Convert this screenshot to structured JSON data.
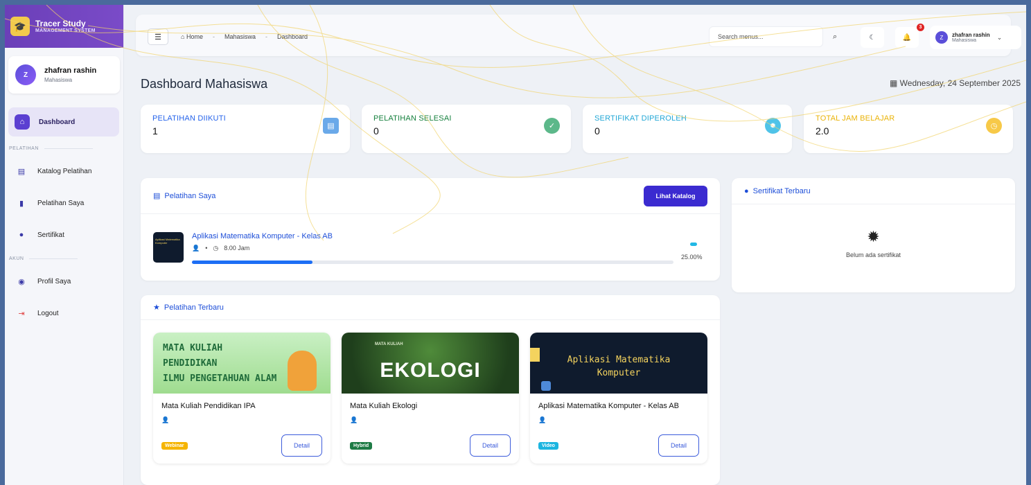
{
  "brand": {
    "title": "Tracer Study",
    "subtitle": "MANAGEMENT SYSTEM",
    "logo_icon": "graduate-icon"
  },
  "user": {
    "initial": "Z",
    "name": "zhafran rashin",
    "role": "Mahasiswa"
  },
  "sidebar": {
    "active": {
      "label": "Dashboard",
      "icon": "home-icon"
    },
    "section_pelatihan": "PELATIHAN",
    "pelatihan_items": [
      {
        "label": "Katalog Pelatihan",
        "icon": "book-icon"
      },
      {
        "label": "Pelatihan Saya",
        "icon": "bookmark-icon"
      },
      {
        "label": "Sertifikat",
        "icon": "certificate-icon"
      }
    ],
    "section_akun": "AKUN",
    "akun_items": [
      {
        "label": "Profil Saya",
        "icon": "user-circle-icon"
      },
      {
        "label": "Logout",
        "icon": "logout-icon"
      }
    ]
  },
  "topbar": {
    "breadcrumbs": [
      "Home",
      "Mahasiswa",
      "Dashboard"
    ],
    "search_placeholder": "Search menus...",
    "notification_count": "3",
    "profile_initial": "Z",
    "profile_name": "zhafran rashin",
    "profile_role": "Mahasiswa"
  },
  "page": {
    "title": "Dashboard Mahasiswa",
    "date": "Wednesday, 24 September 2025"
  },
  "stats": [
    {
      "label": "PELATIHAN DIIKUTI",
      "value": "1",
      "color": "#2563eb",
      "icon": "book-icon",
      "icon_color": "#6aa9e9"
    },
    {
      "label": "PELATIHAN SELESAI",
      "value": "0",
      "color": "#15803d",
      "icon": "check-circle-icon",
      "icon_color": "#5cb88a"
    },
    {
      "label": "SERTIFIKAT DIPEROLEH",
      "value": "0",
      "color": "#22a7d6",
      "icon": "certificate-icon",
      "icon_color": "#4fc3e8"
    },
    {
      "label": "TOTAL JAM BELAJAR",
      "value": "2.0",
      "color": "#eab308",
      "icon": "clock-icon",
      "icon_color": "#f7c948"
    }
  ],
  "pelatihan_saya": {
    "title": "Pelatihan Saya",
    "button": "Lihat Katalog",
    "course": {
      "title": "Aplikasi Matematika Komputer - Kelas AB",
      "hours": "8.00 Jam",
      "progress": 0.25,
      "progress_text": "25.00%",
      "thumb_text": "Aplikasi Matematika Komputer"
    }
  },
  "sertifikat_terbaru": {
    "title": "Sertifikat Terbaru",
    "empty_text": "Belum ada sertifikat"
  },
  "pelatihan_terbaru": {
    "title": "Pelatihan Terbaru",
    "cards": [
      {
        "title": "Mata Kuliah Pendidikan IPA",
        "badge": "Webinar",
        "badge_color": "#f5b400",
        "detail": "Detail",
        "image_lines": [
          "MATA KULIAH",
          "PENDIDIKAN",
          "ILMU PENGETAHUAN ALAM"
        ]
      },
      {
        "title": "Mata Kuliah Ekologi",
        "badge": "Hybrid",
        "badge_color": "#1e7b45",
        "detail": "Detail",
        "image_small": "MATA KULIAH",
        "image_big": "EKOLOGI"
      },
      {
        "title": "Aplikasi Matematika Komputer - Kelas AB",
        "badge": "Video",
        "badge_color": "#1cb5e0",
        "detail": "Detail",
        "image_lines": [
          "Aplikasi Matematika",
          "Komputer"
        ]
      }
    ]
  }
}
